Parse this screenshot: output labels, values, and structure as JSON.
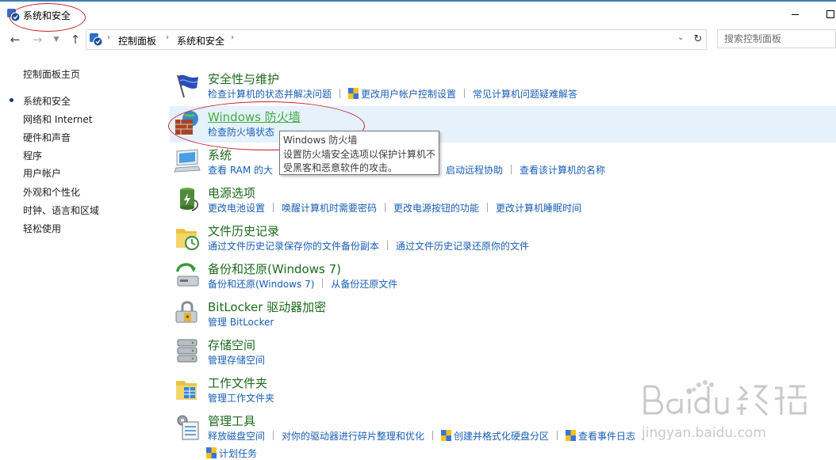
{
  "window": {
    "title": "系统和安全"
  },
  "address_bar": {
    "breadcrumbs": [
      "控制面板",
      "系统和安全"
    ],
    "search_placeholder": "搜索控制面板"
  },
  "sidebar": {
    "items": [
      {
        "label": "控制面板主页",
        "current": false
      },
      {
        "label": "系统和安全",
        "current": true
      },
      {
        "label": "网络和 Internet",
        "current": false
      },
      {
        "label": "硬件和声音",
        "current": false
      },
      {
        "label": "程序",
        "current": false
      },
      {
        "label": "用户帐户",
        "current": false
      },
      {
        "label": "外观和个性化",
        "current": false
      },
      {
        "label": "时钟、语言和区域",
        "current": false
      },
      {
        "label": "轻松使用",
        "current": false
      }
    ]
  },
  "categories": [
    {
      "title": "安全性与维护",
      "icon": "security-flag-icon",
      "links": [
        "检查计算机的状态并解决问题",
        "更改用户帐户控制设置",
        "常见计算机问题疑难解答"
      ]
    },
    {
      "title": "Windows 防火墙",
      "icon": "firewall-icon",
      "links": [
        "检查防火墙状态"
      ]
    },
    {
      "title": "系统",
      "icon": "computer-icon",
      "links": [
        "查看 RAM 的大",
        "启动远程协助",
        "查看该计算机的名称"
      ]
    },
    {
      "title": "电源选项",
      "icon": "battery-icon",
      "links": [
        "更改电池设置",
        "唤醒计算机时需要密码",
        "更改电源按钮的功能",
        "更改计算机睡眠时间"
      ]
    },
    {
      "title": "文件历史记录",
      "icon": "file-history-icon",
      "links": [
        "通过文件历史记录保存你的文件备份副本",
        "通过文件历史记录还原你的文件"
      ]
    },
    {
      "title": "备份和还原(Windows 7)",
      "icon": "backup-icon",
      "links": [
        "备份和还原(Windows 7)",
        "从备份还原文件"
      ]
    },
    {
      "title": "BitLocker 驱动器加密",
      "icon": "bitlocker-icon",
      "links": [
        "管理 BitLocker"
      ]
    },
    {
      "title": "存储空间",
      "icon": "storage-icon",
      "links": [
        "管理存储空间"
      ]
    },
    {
      "title": "工作文件夹",
      "icon": "work-folders-icon",
      "links": [
        "管理工作文件夹"
      ]
    },
    {
      "title": "管理工具",
      "icon": "admin-tools-icon",
      "links": [
        "释放磁盘空间",
        "对你的驱动器进行碎片整理和优化",
        "创建并格式化硬盘分区",
        "查看事件日志",
        "计划任务"
      ]
    }
  ],
  "tooltip": {
    "title": "Windows 防火墙",
    "body": "设置防火墙安全选项以保护计算机不受黑客和恶意软件的攻击。"
  },
  "colors": {
    "link": "#1a5eb5",
    "category_title": "#1e6b1e",
    "hover_title": "#3fae3f",
    "hover_row": "#e5f1fb",
    "annotation": "#c8232c"
  }
}
